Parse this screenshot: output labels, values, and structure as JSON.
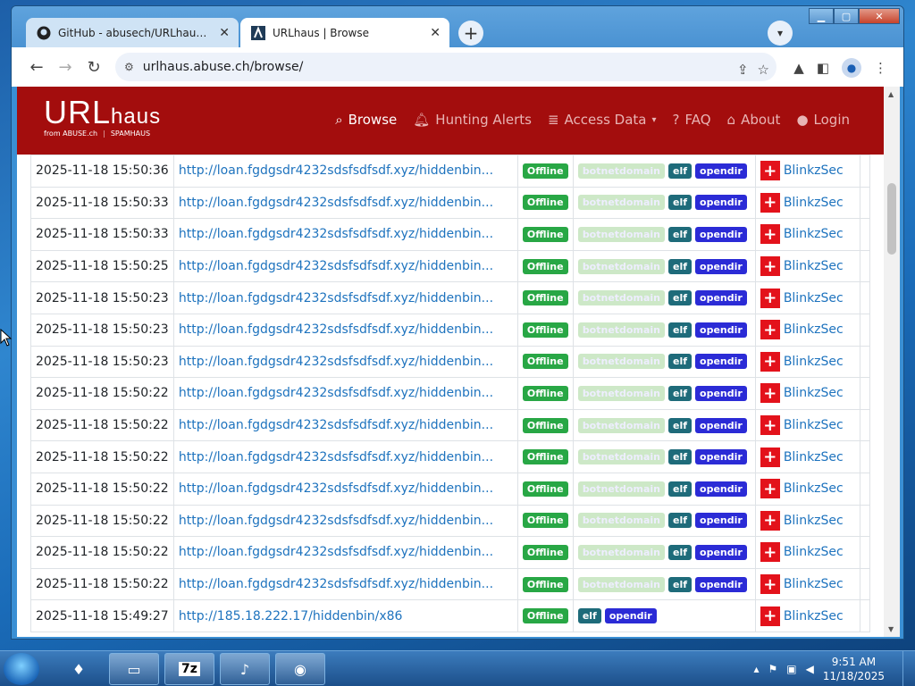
{
  "browser": {
    "tabs": [
      {
        "title": "GitHub - abusech/URLhaus: Ope",
        "close": "✕"
      },
      {
        "title": "URLhaus | Browse",
        "close": "✕"
      }
    ],
    "url": "urlhaus.abuse.ch/browse/"
  },
  "site": {
    "logo_main": "URL",
    "logo_sub": "haus",
    "from_label": "from ABUSE.ch",
    "spamhaus_label": "SPAMHAUS",
    "nav": [
      {
        "label": "Browse",
        "icon": "search-icon"
      },
      {
        "label": "Hunting Alerts",
        "icon": "bell-icon"
      },
      {
        "label": "Access Data",
        "icon": "database-icon"
      },
      {
        "label": "FAQ",
        "icon": "question-icon"
      },
      {
        "label": "About",
        "icon": "building-icon"
      },
      {
        "label": "Login",
        "icon": "user-icon"
      }
    ]
  },
  "rows": [
    {
      "date": "2025-11-18 15:50:36",
      "url": "http://loan.fgdgsdr4232sdsfsdfsdf.xyz/hiddenbin...",
      "status": "Offline",
      "tags": [
        "botnetdomain",
        "elf",
        "opendir"
      ],
      "reporter": "BlinkzSec"
    },
    {
      "date": "2025-11-18 15:50:33",
      "url": "http://loan.fgdgsdr4232sdsfsdfsdf.xyz/hiddenbin...",
      "status": "Offline",
      "tags": [
        "botnetdomain",
        "elf",
        "opendir"
      ],
      "reporter": "BlinkzSec"
    },
    {
      "date": "2025-11-18 15:50:33",
      "url": "http://loan.fgdgsdr4232sdsfsdfsdf.xyz/hiddenbin...",
      "status": "Offline",
      "tags": [
        "botnetdomain",
        "elf",
        "opendir"
      ],
      "reporter": "BlinkzSec"
    },
    {
      "date": "2025-11-18 15:50:25",
      "url": "http://loan.fgdgsdr4232sdsfsdfsdf.xyz/hiddenbin...",
      "status": "Offline",
      "tags": [
        "botnetdomain",
        "elf",
        "opendir"
      ],
      "reporter": "BlinkzSec"
    },
    {
      "date": "2025-11-18 15:50:23",
      "url": "http://loan.fgdgsdr4232sdsfsdfsdf.xyz/hiddenbin...",
      "status": "Offline",
      "tags": [
        "botnetdomain",
        "elf",
        "opendir"
      ],
      "reporter": "BlinkzSec"
    },
    {
      "date": "2025-11-18 15:50:23",
      "url": "http://loan.fgdgsdr4232sdsfsdfsdf.xyz/hiddenbin...",
      "status": "Offline",
      "tags": [
        "botnetdomain",
        "elf",
        "opendir"
      ],
      "reporter": "BlinkzSec"
    },
    {
      "date": "2025-11-18 15:50:23",
      "url": "http://loan.fgdgsdr4232sdsfsdfsdf.xyz/hiddenbin...",
      "status": "Offline",
      "tags": [
        "botnetdomain",
        "elf",
        "opendir"
      ],
      "reporter": "BlinkzSec"
    },
    {
      "date": "2025-11-18 15:50:22",
      "url": "http://loan.fgdgsdr4232sdsfsdfsdf.xyz/hiddenbin...",
      "status": "Offline",
      "tags": [
        "botnetdomain",
        "elf",
        "opendir"
      ],
      "reporter": "BlinkzSec"
    },
    {
      "date": "2025-11-18 15:50:22",
      "url": "http://loan.fgdgsdr4232sdsfsdfsdf.xyz/hiddenbin...",
      "status": "Offline",
      "tags": [
        "botnetdomain",
        "elf",
        "opendir"
      ],
      "reporter": "BlinkzSec"
    },
    {
      "date": "2025-11-18 15:50:22",
      "url": "http://loan.fgdgsdr4232sdsfsdfsdf.xyz/hiddenbin...",
      "status": "Offline",
      "tags": [
        "botnetdomain",
        "elf",
        "opendir"
      ],
      "reporter": "BlinkzSec"
    },
    {
      "date": "2025-11-18 15:50:22",
      "url": "http://loan.fgdgsdr4232sdsfsdfsdf.xyz/hiddenbin...",
      "status": "Offline",
      "tags": [
        "botnetdomain",
        "elf",
        "opendir"
      ],
      "reporter": "BlinkzSec"
    },
    {
      "date": "2025-11-18 15:50:22",
      "url": "http://loan.fgdgsdr4232sdsfsdfsdf.xyz/hiddenbin...",
      "status": "Offline",
      "tags": [
        "botnetdomain",
        "elf",
        "opendir"
      ],
      "reporter": "BlinkzSec"
    },
    {
      "date": "2025-11-18 15:50:22",
      "url": "http://loan.fgdgsdr4232sdsfsdfsdf.xyz/hiddenbin...",
      "status": "Offline",
      "tags": [
        "botnetdomain",
        "elf",
        "opendir"
      ],
      "reporter": "BlinkzSec"
    },
    {
      "date": "2025-11-18 15:50:22",
      "url": "http://loan.fgdgsdr4232sdsfsdfsdf.xyz/hiddenbin...",
      "status": "Offline",
      "tags": [
        "botnetdomain",
        "elf",
        "opendir"
      ],
      "reporter": "BlinkzSec"
    },
    {
      "date": "2025-11-18 15:49:27",
      "url": "http://185.18.222.17/hiddenbin/x86",
      "status": "Offline",
      "tags": [
        "elf",
        "opendir"
      ],
      "reporter": "BlinkzSec"
    }
  ],
  "taskbar": {
    "time": "9:51 AM",
    "date": "11/18/2025",
    "items": [
      "app-icon",
      "folder-icon",
      "7z-icon",
      "media-icon",
      "browser-icon"
    ],
    "sevenzip_label": "7z"
  },
  "colors": {
    "brand_red": "#a30d0d",
    "offline_green": "#28a745",
    "elf_teal": "#1e6b7a",
    "opendir_blue": "#2b2bd6",
    "link_blue": "#1e73be"
  }
}
